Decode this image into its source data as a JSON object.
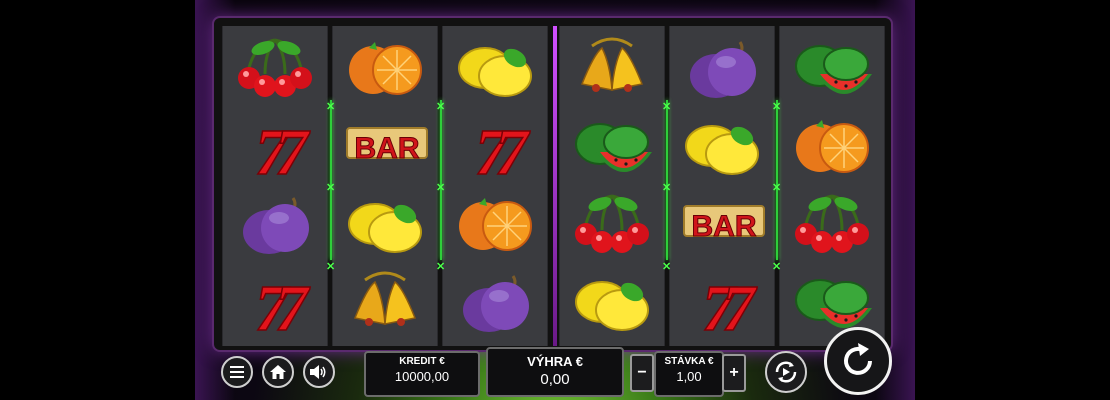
{
  "toolbar": {
    "menu_icon": "hamburger-icon",
    "home_icon": "home-icon",
    "sound_icon": "speaker-icon"
  },
  "credit": {
    "label": "KREDIT €",
    "value": "10000,00"
  },
  "win": {
    "label": "VÝHRA €",
    "value": "0,00"
  },
  "bet": {
    "label": "STÁVKA €",
    "minus": "−",
    "plus": "+",
    "value": "1,00"
  },
  "autoplay_icon": "autoplay-icon",
  "spin_icon": "spin-arrow-icon",
  "reels": [
    [
      "cherry",
      "seven",
      "plum",
      "seven"
    ],
    [
      "orange",
      "bar",
      "lemon",
      "bell"
    ],
    [
      "lemon",
      "seven",
      "orange",
      "plum"
    ],
    [
      "bell",
      "watermelon",
      "cherry",
      "lemon"
    ],
    [
      "plum",
      "lemon",
      "bar",
      "seven"
    ],
    [
      "watermelon",
      "orange",
      "cherry",
      "watermelon"
    ]
  ],
  "bar_text": "BAR",
  "seven_text": "7",
  "colors": {
    "frame_glow": "#7a2fa0",
    "payline": "#2ecf3a",
    "reel_bg": "#3a3b3f"
  }
}
